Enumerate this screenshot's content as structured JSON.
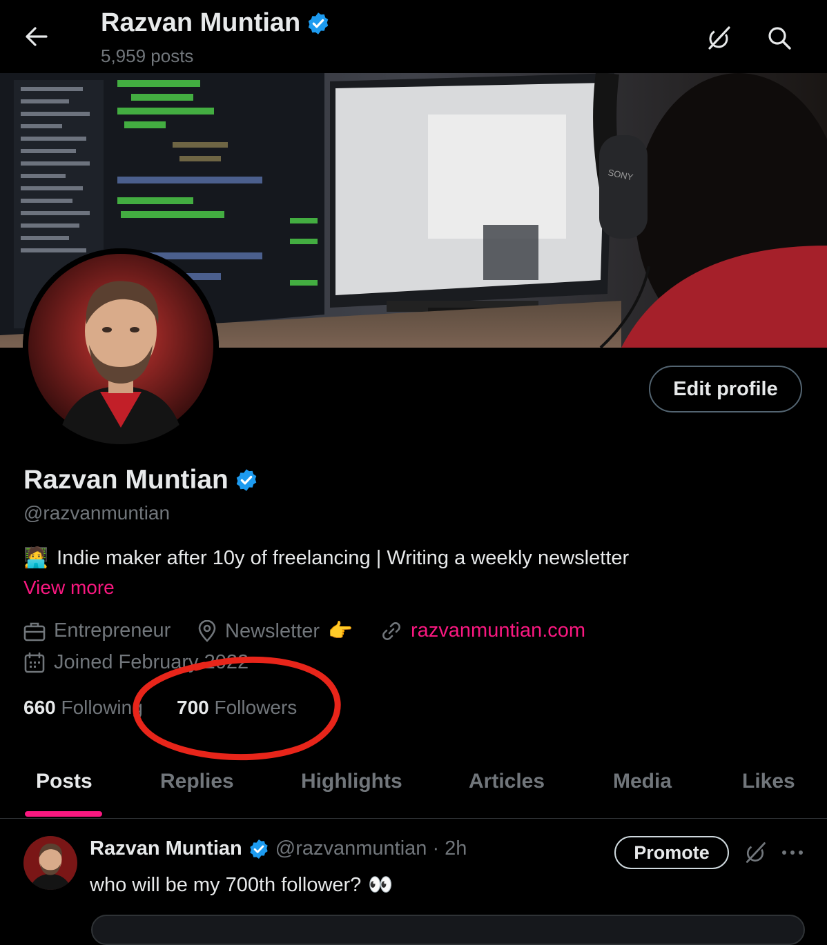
{
  "header": {
    "name": "Razvan Muntian",
    "posts_count": "5,959 posts",
    "back_icon": "arrow-left-icon",
    "grok_icon": "grok-icon",
    "search_icon": "search-icon"
  },
  "profile": {
    "display_name": "Razvan Muntian",
    "handle": "@razvanmuntian",
    "bio": "Indie maker after 10y of freelancing | Writing a weekly newsletter",
    "bio_emoji": "🧑‍💻",
    "view_more": "View more",
    "edit_profile": "Edit profile",
    "verified_color": "#1d9bf0",
    "accent_color": "#f91880"
  },
  "meta": {
    "profession": "Entrepreneur",
    "location": "Newsletter",
    "location_emoji": "👉",
    "url": "razvanmuntian.com",
    "joined": "Joined February 2022"
  },
  "stats": {
    "following_count": "660",
    "following_label": "Following",
    "followers_count": "700",
    "followers_label": "Followers"
  },
  "tabs": [
    {
      "label": "Posts",
      "active": true
    },
    {
      "label": "Replies",
      "active": false
    },
    {
      "label": "Highlights",
      "active": false
    },
    {
      "label": "Articles",
      "active": false
    },
    {
      "label": "Media",
      "active": false
    },
    {
      "label": "Likes",
      "active": false
    }
  ],
  "post": {
    "author": "Razvan Muntian",
    "meta": "@razvanmuntian · 2h",
    "text": "who will be my 700th follower?",
    "text_emoji": "👀",
    "promote": "Promote"
  },
  "annotation": {
    "circle_color": "#e8251a"
  }
}
